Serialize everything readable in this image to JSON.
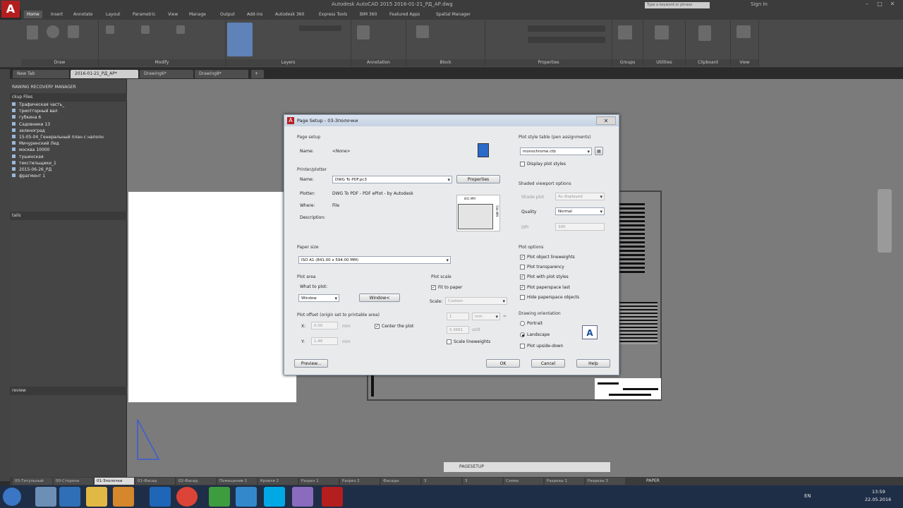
{
  "titlebar": {
    "title": "Autodesk AutoCAD 2015    2016-01-21_РД_АР.dwg",
    "search_placeholder": "Type a keyword or phrase",
    "signin": "Sign In",
    "logo": "A"
  },
  "ribbon_tabs": [
    "Home",
    "Insert",
    "Annotate",
    "Layout",
    "Parametric",
    "View",
    "Manage",
    "Output",
    "Add-ins",
    "Autodesk 360",
    "Express Tools",
    "BIM 360",
    "Featured Apps",
    "Spatial Manager"
  ],
  "ribbon_panels": [
    "Draw",
    "Modify",
    "Layers",
    "Annotation",
    "Block",
    "Properties",
    "Groups",
    "Utilities",
    "Clipboard",
    "View"
  ],
  "doc_tabs": [
    "New Tab",
    "2016-01-21_РД_АР*",
    "Drawing6*",
    "Drawing8*"
  ],
  "recovery": {
    "header": "RAWING RECOVERY MANAGER",
    "backup_header": "ckup Files",
    "items": [
      "Трафическая часть_",
      "триотгорный вал",
      "губкина 6",
      "Садовники 13",
      "зеленоград",
      "15-05-04_Генеральный план с наполн",
      "Мичуринский Лед",
      "москва 10000",
      "тушинская",
      "текстильщики_1",
      "2015-06-26_РД",
      "фрагмент 1"
    ],
    "details_header": "tails",
    "preview_header": "review"
  },
  "dialog": {
    "title": "Page Setup - 03-Зполочки",
    "close": "✕",
    "page_setup_group": "Page setup",
    "name_label": "Name:",
    "name_value": "<None>",
    "printer_group": "Printer/plotter",
    "printer_name_label": "Name:",
    "printer_name_value": "DWG To PDF.pc3",
    "properties_btn": "Properties",
    "plotter_label": "Plotter:",
    "plotter_value": "DWG To PDF - PDF ePlot - by Autodesk",
    "where_label": "Where:",
    "where_value": "File",
    "description_label": "Description:",
    "preview_width": "841 MM",
    "preview_height": "594 MM",
    "paper_size_group": "Paper size",
    "paper_size_value": "ISO A1 (841.00 x 594.00 MM)",
    "plot_area_group": "Plot area",
    "what_to_plot_label": "What to plot:",
    "what_to_plot_value": "Window",
    "window_btn": "Window<",
    "plot_scale_group": "Plot scale",
    "fit_to_paper": "Fit to paper",
    "scale_label": "Scale:",
    "scale_value": "Custom",
    "scale_num": "1",
    "scale_unit": "mm",
    "scale_den": "0.3661",
    "scale_unit2": "unit",
    "scale_lineweights": "Scale lineweights",
    "plot_offset_group": "Plot offset (origin set to printable area)",
    "x_label": "X:",
    "x_value": "0.00",
    "y_label": "Y:",
    "y_value": "1.46",
    "mm1": "mm",
    "mm2": "mm",
    "center_plot": "Center the plot",
    "style_table_group": "Plot style table (pen assignments)",
    "style_table_value": "monochrome.ctb",
    "display_styles": "Display plot styles",
    "shaded_group": "Shaded viewport options",
    "shade_plot_label": "Shade plot",
    "shade_plot_value": "As displayed",
    "quality_label": "Quality",
    "quality_value": "Normal",
    "dpi_label": "DPI",
    "dpi_value": "300",
    "options_group": "Plot options",
    "opt_lineweights": "Plot object lineweights",
    "opt_transparency": "Plot transparency",
    "opt_styles": "Plot with plot styles",
    "opt_paperspace_last": "Plot paperspace last",
    "opt_hide": "Hide paperspace objects",
    "orientation_group": "Drawing orientation",
    "portrait": "Portrait",
    "landscape": "Landscape",
    "upside_down": "Plot upside-down",
    "preview_btn": "Preview...",
    "ok_btn": "OK",
    "cancel_btn": "Cancel",
    "help_btn": "Help"
  },
  "command_line": "PAGESETUP",
  "layout_tabs": [
    "00-Титульный",
    "00-Сторона",
    "01-Зполочки",
    "01-Фасад",
    "02-Фасад",
    "Помещение 1",
    "Кровля 2",
    "Разрез 1",
    "Разрез 2",
    "Фасады",
    "3",
    "3",
    "Схема",
    "Разрезы 1",
    "Разрезы 3",
    "Разрез 5",
    "Детали"
  ],
  "active_layout_index": 2,
  "status": {
    "paper": "PAPER"
  },
  "clock": {
    "time": "13:59",
    "date": "22.05.2016"
  },
  "language": "EN",
  "colors": {
    "accent": "#b41e1e",
    "ribbon_bg": "#4a4a4a",
    "canvas": "#7b7b7b",
    "taskbar": "#1f2e47"
  }
}
